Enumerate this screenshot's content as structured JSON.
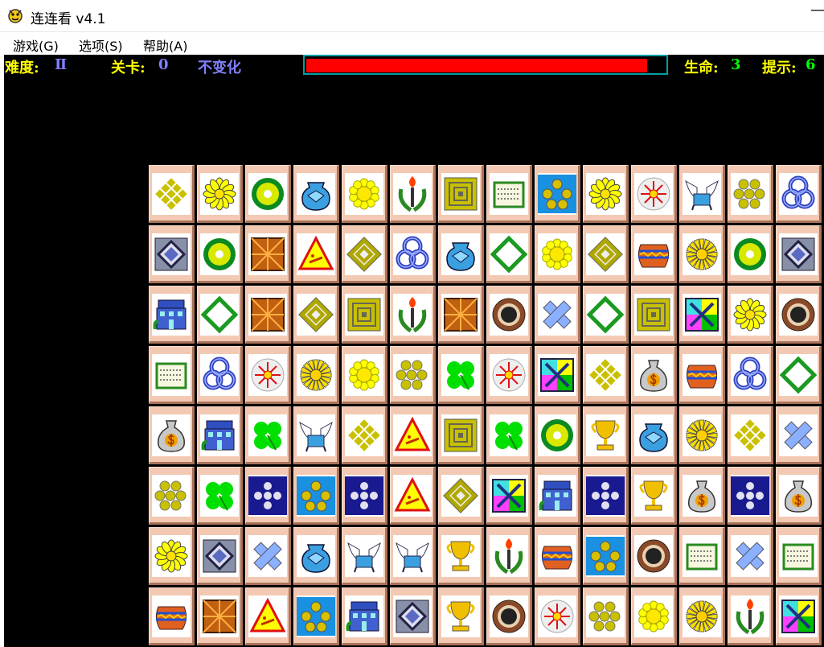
{
  "window": {
    "title": "连连看 v4.1",
    "minimize_glyph": "—"
  },
  "menu": [
    {
      "label": "游戏(G)"
    },
    {
      "label": "选项(S)"
    },
    {
      "label": "帮助(A)"
    }
  ],
  "status": {
    "difficulty_label": "难度:",
    "difficulty_value": "Ⅱ",
    "level_label": "关卡:",
    "level_value": "0",
    "mode": "不变化",
    "time_remaining_fraction": 0.95,
    "lives_label": "生命:",
    "lives_value": "3",
    "hints_label": "提示:",
    "hints_value": "6"
  },
  "colors": {
    "background": "#000000",
    "label": "#ffff00",
    "value_blue": "#8080ff",
    "value_green": "#00ff00",
    "time_bar": "#ff0000",
    "tile": "#f3c9b3"
  },
  "board": {
    "rows": [
      [
        "knot-gold",
        "daisy",
        "green-disk",
        "blue-vase",
        "sun-flower",
        "torch-laurel",
        "spiral-square",
        "scroll",
        "five-balls-blue",
        "daisy",
        "compass-disk",
        "winged-chair",
        "grape-cluster",
        "blue-knot"
      ],
      [
        "blue-diamond",
        "green-disk",
        "brown-star-box",
        "warning-sign",
        "gold-diamond",
        "blue-knot",
        "blue-vase",
        "green-diamond",
        "sun-flower",
        "gold-diamond",
        "striped-pot",
        "chrysanthemum",
        "green-disk",
        "blue-diamond"
      ],
      [
        "blue-house",
        "green-diamond",
        "brown-star-box",
        "gold-diamond",
        "spiral-square",
        "torch-laurel",
        "brown-star-box",
        "bronze-ring",
        "blue-cross",
        "green-diamond",
        "spiral-square",
        "arrows-square",
        "daisy",
        "bronze-ring"
      ],
      [
        "scroll",
        "blue-knot",
        "compass-disk",
        "chrysanthemum",
        "sun-flower",
        "grape-cluster",
        "green-clover",
        "compass-disk",
        "arrows-square",
        "knot-gold",
        "money-bag",
        "striped-pot",
        "blue-knot",
        "green-diamond"
      ],
      [
        "money-bag",
        "blue-house",
        "green-clover",
        "winged-chair",
        "knot-gold",
        "warning-sign",
        "spiral-square",
        "green-clover",
        "green-disk",
        "gold-trophy",
        "blue-vase",
        "chrysanthemum",
        "knot-gold",
        "blue-cross"
      ],
      [
        "grape-cluster",
        "green-clover",
        "dots-navy",
        "five-balls-blue",
        "dots-navy",
        "warning-sign",
        "gold-diamond",
        "arrows-square",
        "blue-house",
        "dots-navy",
        "gold-trophy",
        "money-bag",
        "dots-navy",
        "money-bag"
      ],
      [
        "daisy",
        "blue-diamond",
        "blue-cross",
        "blue-vase",
        "winged-chair",
        "winged-chair",
        "gold-trophy",
        "torch-laurel",
        "striped-pot",
        "five-balls-blue",
        "bronze-ring",
        "scroll",
        "blue-cross",
        "scroll"
      ],
      [
        "striped-pot",
        "brown-star-box",
        "warning-sign",
        "five-balls-blue",
        "blue-house",
        "blue-diamond",
        "gold-trophy",
        "bronze-ring",
        "compass-disk",
        "grape-cluster",
        "sun-flower",
        "chrysanthemum",
        "torch-laurel",
        "arrows-square"
      ]
    ]
  }
}
